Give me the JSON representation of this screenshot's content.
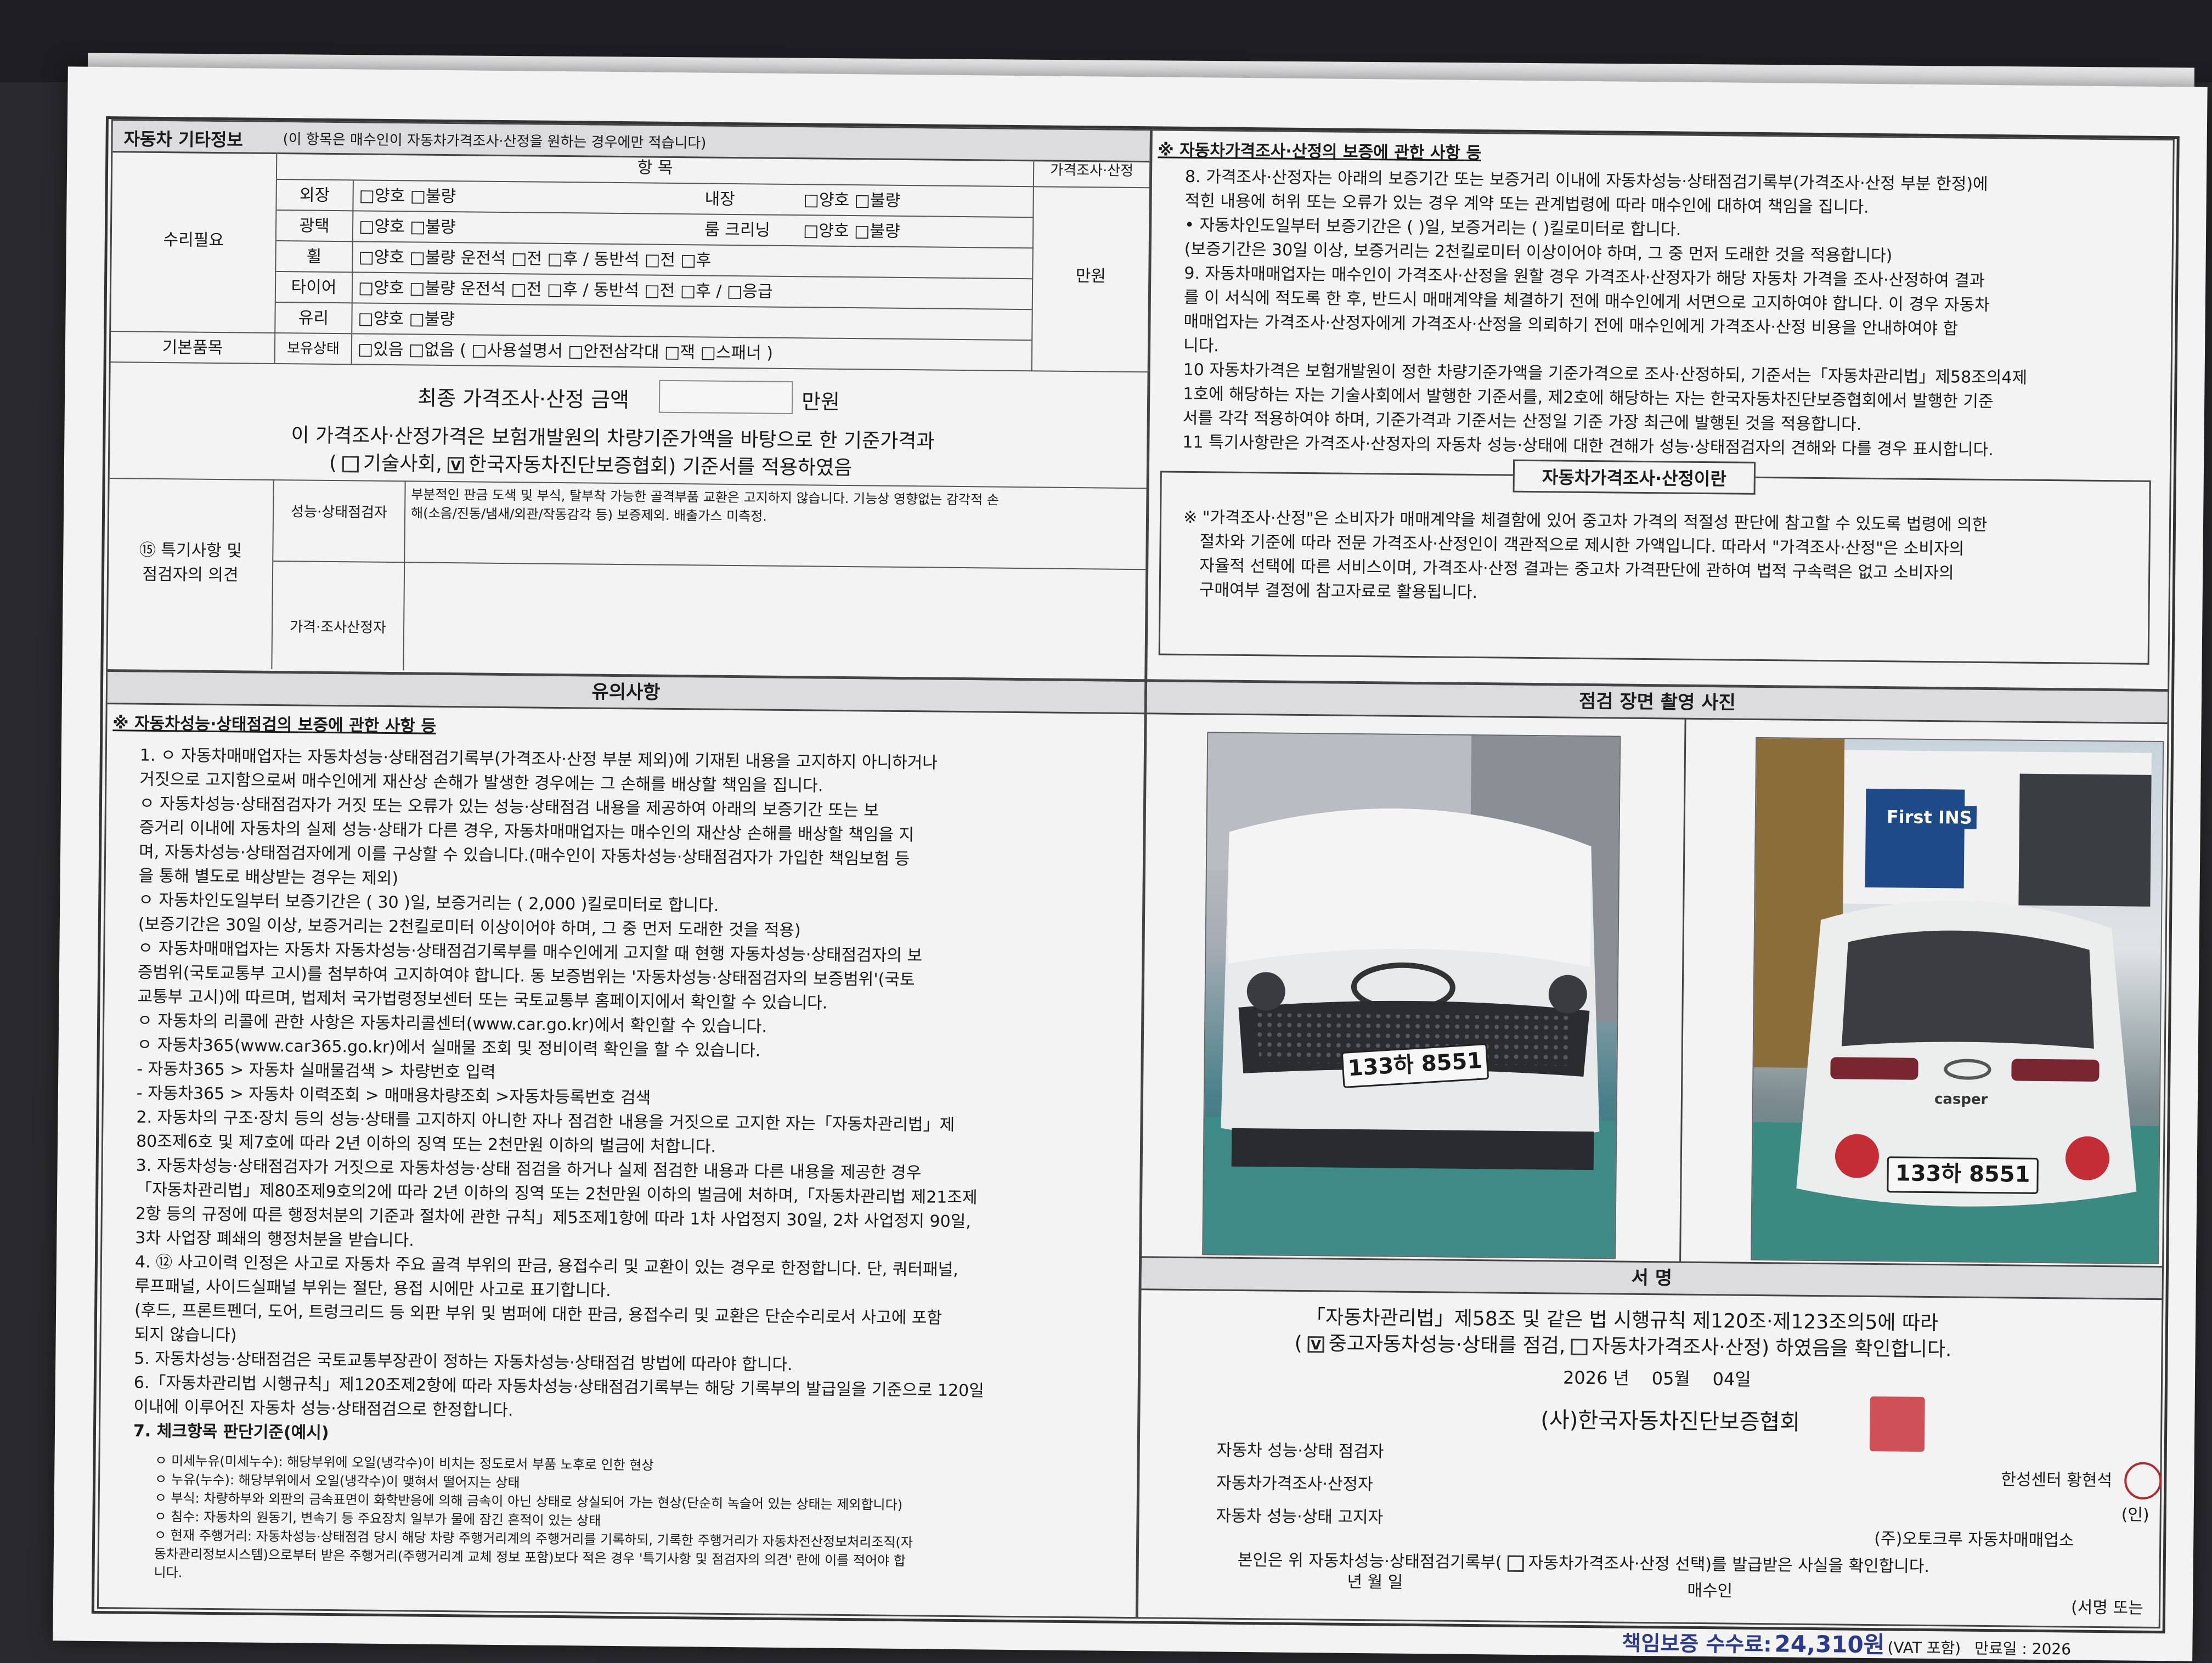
{
  "left_top": {
    "title": "자동차 기타정보",
    "title_note": "(이 항목은 매수인이 자동차가격조사·산정을 원하는 경우에만 적습니다)",
    "col_item": "항 목",
    "col_price": "가격조사·산정",
    "repair_label": "수리필요",
    "rows": [
      {
        "name": "외장",
        "opts": "□양호 □불량",
        "name2": "내장",
        "opts2": "□양호 □불량"
      },
      {
        "name": "광택",
        "opts": "□양호 □불량",
        "name2": "룸 크리닝",
        "opts2": "□양호 □불량"
      },
      {
        "name": "휠",
        "opts": "□양호 □불량 운전석 □전 □후 / 동반석 □전 □후"
      },
      {
        "name": "타이어",
        "opts": "□양호 □불량 운전석 □전 □후 / 동반석 □전 □후 / □응급"
      },
      {
        "name": "유리",
        "opts": "□양호 □불량"
      }
    ],
    "basic_label": "기본품목",
    "basic_sub": "보유상태",
    "basic_opts": "□있음 □없음 ( □사용설명서 □안전삼각대 □잭 □스패너 )",
    "unit": "만원",
    "final_label": "최종 가격조사·산정 금액",
    "final_unit": "만원",
    "basis_line1": "이 가격조사·산정가격은 보험개발원의 차량기준가액을 바탕으로 한 기준가격과",
    "basis_line2_a": "(",
    "basis_opt1": "기술사회,",
    "basis_opt2": "한국자동차진단보증협회) 기준서를 적용하였음",
    "special_label1": "⑮ 특기사항 및",
    "special_label2": "점검자의 의견",
    "inspector_label": "성능·상태점검자",
    "inspector_text1": "부분적인 판금 도색 및 부식, 탈부착 가능한 골격부품 교환은 고지하지 않습니다. 기능상 영향없는 감각적 손",
    "inspector_text2": "해(소음/진동/냄새/외관/작동감각 등) 보증제외. 배출가스 미측정.",
    "appraiser_label": "가격·조사산정자"
  },
  "right_top": {
    "heading": "※ 자동차가격조사·산정의 보증에 관한 사항 등",
    "items": [
      "8. 가격조사·산정자는 아래의 보증기간 또는 보증거리 이내에 자동차성능·상태점검기록부(가격조사·산정 부분 한정)에",
      "   적힌 내용에 허위 또는 오류가 있는 경우 계약 또는 관계법령에 따라 매수인에 대하여 책임을 집니다.",
      "   • 자동차인도일부터 보증기간은 (     )일, 보증거리는 (     )킬로미터로 합니다.",
      "   (보증기간은 30일 이상, 보증거리는 2천킬로미터 이상이어야 하며, 그 중 먼저 도래한 것을 적용합니다)",
      "9. 자동차매매업자는 매수인이 가격조사·산정을 원할 경우 가격조사·산정자가 해당 자동차 가격을 조사·산정하여 결과",
      "   를 이 서식에 적도록 한 후, 반드시 매매계약을 체결하기 전에 매수인에게 서면으로 고지하여야 합니다. 이 경우 자동차",
      "   매매업자는 가격조사·산정자에게 가격조사·산정을 의뢰하기 전에 매수인에게 가격조사·산정 비용을 안내하여야 합",
      "   니다.",
      "10 자동차가격은 보험개발원이 정한 차량기준가액을 기준가격으로 조사·산정하되, 기준서는「자동차관리법」제58조의4제",
      "   1호에 해당하는 자는 기술사회에서 발행한 기준서를, 제2호에 해당하는 자는 한국자동차진단보증협회에서 발행한 기준",
      "   서를 각각 적용하여야 하며, 기준가격과 기준서는 산정일 기준 가장 최근에 발행된 것을 적용합니다.",
      "11 특기사항란은 가격조사·산정자의 자동차 성능·상태에 대한 견해가 성능·상태점검자의 견해와 다를 경우 표시합니다."
    ],
    "box_title": "자동차가격조사·산정이란",
    "box_lines": [
      "※ \"가격조사·산정\"은 소비자가 매매계약을 체결함에 있어 중고차 가격의 적절성 판단에 참고할 수 있도록 법령에 의한",
      "절차와 기준에 따라 전문 가격조사·산정인이 객관적으로 제시한 가액입니다. 따라서 \"가격조사·산정\"은 소비자의",
      "자율적 선택에 따른 서비스이며, 가격조사·산정 결과는 중고차 가격판단에 관하여 법적 구속력은 없고 소비자의",
      "구매여부 결정에 참고자료로 활용됩니다."
    ]
  },
  "notes": {
    "header": "유의사항",
    "heading": "※ 자동차성능·상태점검의 보증에 관한 사항 등",
    "lines": [
      "1. ㅇ 자동차매매업자는 자동차성능·상태점검기록부(가격조사·산정 부분 제외)에 기재된 내용을 고지하지 아니하거나",
      "      거짓으로 고지함으로써 매수인에게 재산상 손해가 발생한 경우에는 그 손해를 배상할 책임을 집니다.",
      "   ㅇ 자동차성능·상태점검자가 거짓 또는 오류가 있는 성능·상태점검 내용을 제공하여 아래의 보증기간 또는 보",
      "      증거리 이내에 자동차의 실제 성능·상태가 다른 경우, 자동차매매업자는 매수인의 재산상 손해를 배상할 책임을 지",
      "      며, 자동차성능·상태점검자에게 이를 구상할 수 있습니다.(매수인이 자동차성능·상태점검자가 가입한 책임보험 등",
      "      을 통해 별도로 배상받는 경우는 제외)",
      "   ㅇ 자동차인도일부터 보증기간은 (  30  )일, 보증거리는 (  2,000  )킬로미터로 합니다.",
      "      (보증기간은 30일 이상, 보증거리는 2천킬로미터 이상이어야 하며, 그 중 먼저 도래한 것을 적용)",
      "   ㅇ 자동차매매업자는 자동차 자동차성능·상태점검기록부를 매수인에게 고지할 때 현행 자동차성능·상태점검자의 보",
      "      증범위(국토교통부 고시)를 첨부하여 고지하여야 합니다. 동 보증범위는 '자동차성능·상태점검자의 보증범위'(국토",
      "      교통부 고시)에 따르며, 법제처 국가법령정보센터 또는 국토교통부 홈페이지에서 확인할 수 있습니다.",
      "   ㅇ 자동차의 리콜에 관한 사항은 자동차리콜센터(www.car.go.kr)에서 확인할 수 있습니다.",
      "   ㅇ 자동차365(www.car365.go.kr)에서 실매물 조회 및 정비이력 확인을 할 수 있습니다.",
      "        - 자동차365 > 자동차 실매물검색 > 차량번호 입력",
      "        - 자동차365 > 자동차 이력조회 > 매매용차량조회 >자동차등록번호 검색",
      "2. 자동차의 구조·장치 등의 성능·상태를 고지하지 아니한 자나 점검한 내용을 거짓으로 고지한 자는「자동차관리법」제",
      "   80조제6호 및 제7호에 따라 2년 이하의 징역 또는 2천만원 이하의 벌금에 처합니다.",
      "3. 자동차성능·상태점검자가 거짓으로 자동차성능·상태 점검을 하거나 실제 점검한 내용과 다른 내용을 제공한 경우",
      "   「자동차관리법」제80조제9호의2에 따라 2년 이하의 징역 또는 2천만원 이하의 벌금에 처하며,「자동차관리법 제21조제",
      "   2항 등의 규정에 따른 행정처분의 기준과 절차에 관한 규칙」제5조제1항에 따라 1차 사업정지 30일, 2차 사업정지 90일,",
      "   3차 사업장 폐쇄의 행정처분을 받습니다.",
      "4. ⑫ 사고이력 인정은 사고로 자동차 주요 골격 부위의 판금, 용접수리 및 교환이 있는 경우로 한정합니다. 단, 쿼터패널,",
      "   루프패널, 사이드실패널 부위는 절단, 용접 시에만 사고로 표기합니다.",
      "   (후드, 프론트펜더, 도어, 트렁크리드 등 외판 부위 및 범퍼에 대한 판금, 용접수리 및 교환은 단순수리로서 사고에 포함",
      "   되지 않습니다)",
      "5. 자동차성능·상태점검은 국토교통부장관이 정하는 자동차성능·상태점검 방법에 따라야 합니다.",
      "6.「자동차관리법 시행규칙」제120조제2항에 따라 자동차성능·상태점검기록부는 해당 기록부의 발급일을 기준으로 120일",
      "   이내에 이루어진 자동차 성능·상태점검으로 한정합니다.",
      "7. 체크항목 판단기준(예시)"
    ],
    "criteria": [
      "ㅇ 미세누유(미세누수): 해당부위에 오일(냉각수)이 비치는 정도로서 부품 노후로 인한 현상",
      "ㅇ 누유(누수): 해당부위에서 오일(냉각수)이 맺혀서 떨어지는 상태",
      "ㅇ 부식: 차량하부와 외판의 금속표면이 화학반응에 의해 금속이 아닌 상태로 상실되어 가는 현상(단순히 녹슬어 있는 상태는 제외합니다)",
      "ㅇ 침수: 자동차의 원동기, 변속기 등 주요장치 일부가 물에 잠긴 흔적이 있는 상태",
      "ㅇ 현재 주행거리: 자동차성능·상태점검 당시 해당 차량 주행거리계의 주행거리를 기록하되, 기록한 주행거리가 자동차전산정보처리조직(자",
      "   동차관리정보시스템)으로부터 받은 주행거리(주행거리계 교체 정보 포함)보다 적은 경우 '특기사항 및 점검자의 의견' 란에 이를 적어야 합",
      "   니다."
    ]
  },
  "photos": {
    "header": "점검 장면 촬영 사진",
    "plate1": "133하 8551",
    "plate2": "133하 8551",
    "sign1": "First INS",
    "badge2": "casper"
  },
  "signature": {
    "header": "서    명",
    "law_line": "「자동차관리법」제58조 및 같은 법 시행규칙 제120조·제123조의5에 따라",
    "check_line_a": "(",
    "check_opt1": "중고자동차성능·상태를 점검,",
    "check_opt2": "자동차가격조사·산정) 하였음을 확인합니다.",
    "year": "2026",
    "year_unit": "년",
    "month": "05",
    "month_unit": "월",
    "day": "04",
    "day_unit": "일",
    "org": "(사)한국자동차진단보증협회",
    "roles": [
      "자동차 성능·상태 점검자",
      "자동차가격조사·산정자",
      "자동차 성능·상태 고지자"
    ],
    "center": "한성센터 황현석",
    "dealer": "(주)오토크루 자동차매매업소",
    "seal_mark": "(인)",
    "buyer_line_a": "본인은 위 자동차성능·상태점검기록부(",
    "buyer_line_b": "자동차가격조사·산정 선택)를 발급받은 사실을 확인합니다.",
    "date_blank": "년        월        일",
    "buyer": "매수인",
    "sign_or": "(서명 또는",
    "fee_label": "책임보증 수수료:",
    "fee_value": "24,310원",
    "fee_vat": "(VAT 포함)",
    "expiry": "만료일 : 2026"
  },
  "colors": {
    "paper": "#f3f3f4",
    "header_bg": "#dcdcde",
    "fee_blue": "#2b3a8c",
    "seal_red": "#c8323a"
  }
}
